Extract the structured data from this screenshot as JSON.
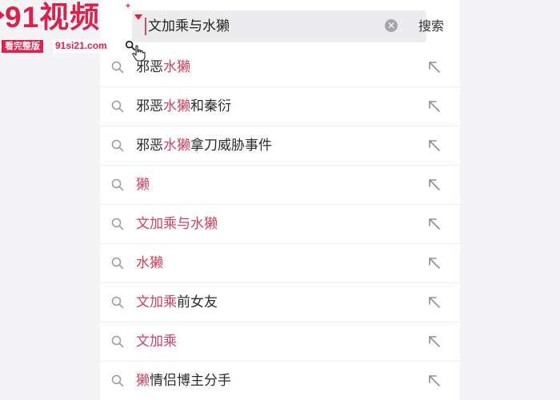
{
  "search": {
    "query": "文加乘与水獭",
    "clear_icon": "clear-circle-icon",
    "button_label": "搜索"
  },
  "suggestions": [
    {
      "parts": [
        {
          "text": "邪恶",
          "hl": false
        },
        {
          "text": "水獭",
          "hl": true
        }
      ]
    },
    {
      "parts": [
        {
          "text": "邪恶",
          "hl": false
        },
        {
          "text": "水獭",
          "hl": true
        },
        {
          "text": "和秦衍",
          "hl": false
        }
      ]
    },
    {
      "parts": [
        {
          "text": "邪恶",
          "hl": false
        },
        {
          "text": "水獭",
          "hl": true
        },
        {
          "text": "拿刀威胁事件",
          "hl": false
        }
      ]
    },
    {
      "parts": [
        {
          "text": "獭",
          "hl": true
        }
      ]
    },
    {
      "parts": [
        {
          "text": "文加乘与水獭",
          "hl": true
        }
      ]
    },
    {
      "parts": [
        {
          "text": "水獭",
          "hl": true
        }
      ]
    },
    {
      "parts": [
        {
          "text": "文加乘",
          "hl": true
        },
        {
          "text": "前女友",
          "hl": false
        }
      ]
    },
    {
      "parts": [
        {
          "text": "文加乘",
          "hl": true
        }
      ]
    },
    {
      "parts": [
        {
          "text": "獭",
          "hl": true
        },
        {
          "text": "情侣博主分手",
          "hl": false
        }
      ]
    }
  ],
  "watermark": {
    "logo_text": "91视频",
    "tag": "看完整版",
    "url": "91si21.com"
  },
  "colors": {
    "highlight": "#d2415e",
    "brand": "#e0204a",
    "text": "#2b2b2b",
    "panel_bg": "#ffffff",
    "page_bg": "#f4f4f6",
    "search_box_bg": "#ececee"
  },
  "icons": {
    "row_leading": "search-icon",
    "row_trailing": "arrow-up-left-icon"
  }
}
